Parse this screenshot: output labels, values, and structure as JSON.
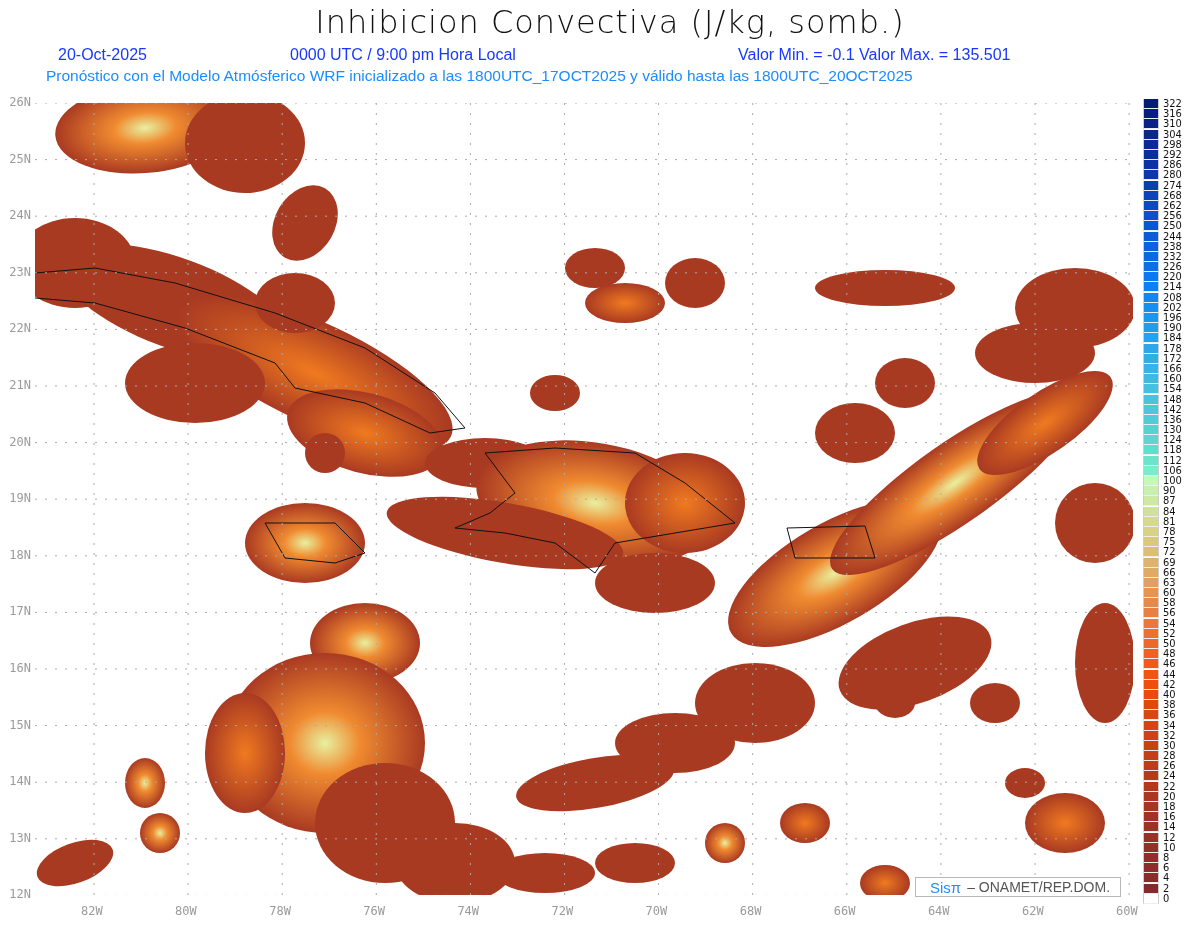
{
  "title": "Inhibicion Convectiva (J/kg, somb.)",
  "info": {
    "date": "20-Oct-2025",
    "time": "0000 UTC / 9:00 pm Hora Local",
    "range": "Valor Min. = -0.1  Valor Max. = 135.501"
  },
  "subtitle": "Pronóstico con el Modelo Atmósferico WRF inicializado a las 1800UTC_17OCT2025 y válido hasta las  1800UTC_20OCT2025",
  "lat_labels": [
    "26N",
    "25N",
    "24N",
    "23N",
    "22N",
    "21N",
    "20N",
    "19N",
    "18N",
    "17N",
    "16N",
    "15N",
    "14N",
    "13N",
    "12N"
  ],
  "lon_labels": [
    "82W",
    "80W",
    "78W",
    "76W",
    "74W",
    "72W",
    "70W",
    "68W",
    "66W",
    "64W",
    "62W",
    "60W"
  ],
  "credit": {
    "brand": "Sisπ",
    "text": "– ONAMET/REP.DOM."
  },
  "legend": [
    {
      "label": "322",
      "color": "#061a78"
    },
    {
      "label": "316",
      "color": "#081e80"
    },
    {
      "label": "310",
      "color": "#0a2288"
    },
    {
      "label": "304",
      "color": "#0a2690"
    },
    {
      "label": "298",
      "color": "#0b2a98"
    },
    {
      "label": "292",
      "color": "#0b2e9e"
    },
    {
      "label": "286",
      "color": "#0c32a4"
    },
    {
      "label": "280",
      "color": "#0c38aa"
    },
    {
      "label": "274",
      "color": "#0c3eb2"
    },
    {
      "label": "268",
      "color": "#0c44ba"
    },
    {
      "label": "262",
      "color": "#0c4ac2"
    },
    {
      "label": "256",
      "color": "#0c50ca"
    },
    {
      "label": "250",
      "color": "#0c56d2"
    },
    {
      "label": "244",
      "color": "#0c5cd8"
    },
    {
      "label": "238",
      "color": "#0a62de"
    },
    {
      "label": "232",
      "color": "#0a68e4"
    },
    {
      "label": "226",
      "color": "#0a70ea"
    },
    {
      "label": "220",
      "color": "#0a78f0"
    },
    {
      "label": "214",
      "color": "#0c80f2"
    },
    {
      "label": "208",
      "color": "#1088f2"
    },
    {
      "label": "202",
      "color": "#1490f0"
    },
    {
      "label": "196",
      "color": "#1a96ee"
    },
    {
      "label": "190",
      "color": "#209cec"
    },
    {
      "label": "184",
      "color": "#26a2ea"
    },
    {
      "label": "178",
      "color": "#2ca8e8"
    },
    {
      "label": "172",
      "color": "#32aee6"
    },
    {
      "label": "166",
      "color": "#38b4e4"
    },
    {
      "label": "160",
      "color": "#3ebae2"
    },
    {
      "label": "154",
      "color": "#44c0e0"
    },
    {
      "label": "148",
      "color": "#48c4de"
    },
    {
      "label": "142",
      "color": "#4cc8da"
    },
    {
      "label": "136",
      "color": "#50ccd6"
    },
    {
      "label": "130",
      "color": "#56d2d2"
    },
    {
      "label": "124",
      "color": "#5cd6ce"
    },
    {
      "label": "118",
      "color": "#64dccc"
    },
    {
      "label": "112",
      "color": "#6ce4cc"
    },
    {
      "label": "106",
      "color": "#78eccc"
    },
    {
      "label": "100",
      "color": "#c6f8b6"
    },
    {
      "label": "90",
      "color": "#c8f0ae"
    },
    {
      "label": "87",
      "color": "#cceaa4"
    },
    {
      "label": "84",
      "color": "#d0e29a"
    },
    {
      "label": "81",
      "color": "#d4da90"
    },
    {
      "label": "78",
      "color": "#d8d286"
    },
    {
      "label": "75",
      "color": "#dac87c"
    },
    {
      "label": "72",
      "color": "#dcbe74"
    },
    {
      "label": "69",
      "color": "#deb46c"
    },
    {
      "label": "66",
      "color": "#e0aa64"
    },
    {
      "label": "63",
      "color": "#e2a05c"
    },
    {
      "label": "60",
      "color": "#e49454"
    },
    {
      "label": "58",
      "color": "#e68a4c"
    },
    {
      "label": "56",
      "color": "#e88044"
    },
    {
      "label": "54",
      "color": "#ea783c"
    },
    {
      "label": "52",
      "color": "#ec7034"
    },
    {
      "label": "50",
      "color": "#ee682c"
    },
    {
      "label": "48",
      "color": "#f06224"
    },
    {
      "label": "46",
      "color": "#f25a1a"
    },
    {
      "label": "44",
      "color": "#f45412"
    },
    {
      "label": "42",
      "color": "#f04e0c"
    },
    {
      "label": "40",
      "color": "#ea4a0c"
    },
    {
      "label": "38",
      "color": "#e2480e"
    },
    {
      "label": "36",
      "color": "#dc4610"
    },
    {
      "label": "34",
      "color": "#d64412"
    },
    {
      "label": "32",
      "color": "#d04214"
    },
    {
      "label": "30",
      "color": "#ca4016"
    },
    {
      "label": "28",
      "color": "#c43e18"
    },
    {
      "label": "26",
      "color": "#be3c1a"
    },
    {
      "label": "24",
      "color": "#b83a1c"
    },
    {
      "label": "22",
      "color": "#b2381e"
    },
    {
      "label": "20",
      "color": "#ac3720"
    },
    {
      "label": "18",
      "color": "#a63622"
    },
    {
      "label": "16",
      "color": "#a03424"
    },
    {
      "label": "14",
      "color": "#9c3326"
    },
    {
      "label": "12",
      "color": "#983228"
    },
    {
      "label": "10",
      "color": "#94302a"
    },
    {
      "label": "8",
      "color": "#902f2c"
    },
    {
      "label": "6",
      "color": "#8c2e2c"
    },
    {
      "label": "4",
      "color": "#882c2c"
    },
    {
      "label": "2",
      "color": "#842a2c"
    },
    {
      "label": "0",
      "color": "#ffffff"
    }
  ]
}
